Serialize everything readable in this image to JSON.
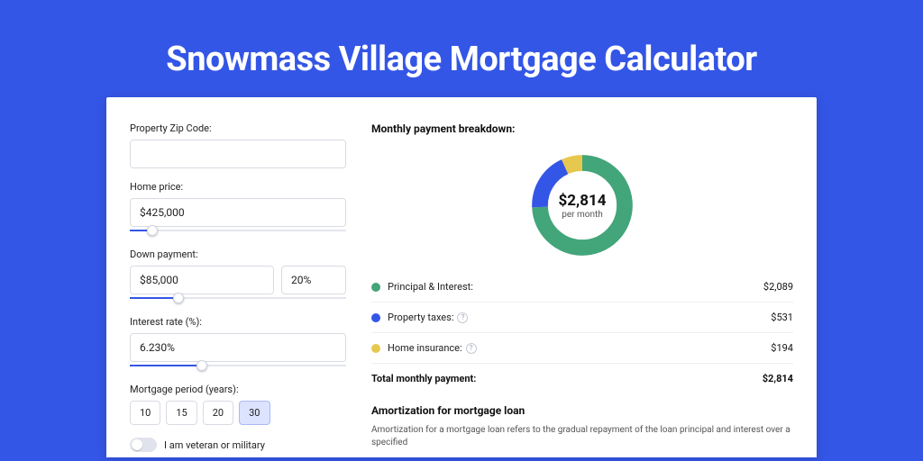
{
  "hero": {
    "title": "Snowmass Village Mortgage Calculator"
  },
  "form": {
    "zip_label": "Property Zip Code:",
    "zip_value": "",
    "home_price_label": "Home price:",
    "home_price_value": "$425,000",
    "down_payment_label": "Down payment:",
    "down_payment_value": "$85,000",
    "down_payment_pct": "20%",
    "interest_label": "Interest rate (%):",
    "interest_value": "6.230%",
    "period_label": "Mortgage period (years):",
    "periods": [
      "10",
      "15",
      "20",
      "30"
    ],
    "period_selected": "30",
    "veteran_label": "I am veteran or military"
  },
  "breakdown": {
    "title": "Monthly payment breakdown:",
    "center_amount": "$2,814",
    "center_sub": "per month",
    "items": [
      {
        "label": "Principal & Interest:",
        "value": "$2,089",
        "color": "#43a57a",
        "info": false
      },
      {
        "label": "Property taxes:",
        "value": "$531",
        "color": "#3456e6",
        "info": true
      },
      {
        "label": "Home insurance:",
        "value": "$194",
        "color": "#e7c84f",
        "info": true
      }
    ],
    "total_label": "Total monthly payment:",
    "total_value": "$2,814"
  },
  "amort": {
    "title": "Amortization for mortgage loan",
    "text": "Amortization for a mortgage loan refers to the gradual repayment of the loan principal and interest over a specified"
  },
  "chart_data": {
    "type": "pie",
    "title": "Monthly payment breakdown",
    "series": [
      {
        "name": "Principal & Interest",
        "value": 2089,
        "color": "#43a57a"
      },
      {
        "name": "Property taxes",
        "value": 531,
        "color": "#3456e6"
      },
      {
        "name": "Home insurance",
        "value": 194,
        "color": "#e7c84f"
      }
    ],
    "total": 2814,
    "center_label": "$2,814 per month"
  }
}
